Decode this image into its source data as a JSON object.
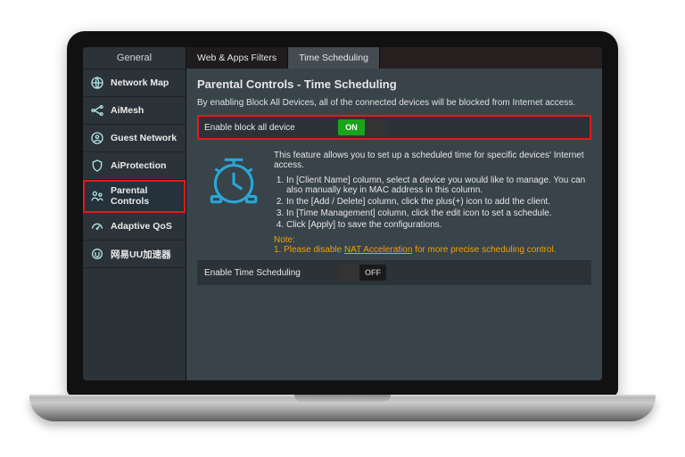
{
  "sidebar": {
    "header": "General",
    "items": [
      {
        "icon": "globe-icon",
        "label": "Network Map"
      },
      {
        "icon": "mesh-icon",
        "label": "AiMesh"
      },
      {
        "icon": "guest-icon",
        "label": "Guest Network"
      },
      {
        "icon": "shield-icon",
        "label": "AiProtection"
      },
      {
        "icon": "family-icon",
        "label": "Parental Controls"
      },
      {
        "icon": "gauge-icon",
        "label": "Adaptive QoS"
      },
      {
        "icon": "accel-icon",
        "label": "网易UU加速器"
      }
    ],
    "active_index": 4
  },
  "tabs": {
    "items": [
      "Web & Apps Filters",
      "Time Scheduling"
    ],
    "active_index": 1
  },
  "page": {
    "title": "Parental Controls - Time Scheduling",
    "subtitle": "By enabling Block All Devices, all of the connected devices will be blocked from Internet access.",
    "row_block": {
      "label": "Enable block all device",
      "state": "ON"
    },
    "feature_desc": "This feature allows you to set up a scheduled time for specific devices' Internet access.",
    "steps": [
      "In [Client Name] column, select a device you would like to manage. You can also manually key in MAC address in this column.",
      "In the [Add / Delete] column, click the plus(+) icon to add the client.",
      "In [Time Management] column, click the edit icon to set a schedule.",
      "Click [Apply] to save the configurations."
    ],
    "note_label": "Note:",
    "note_prefix": "1. Please disable ",
    "note_link": "NAT Acceleration",
    "note_suffix": " for more precise scheduling control.",
    "row_time": {
      "label": "Enable Time Scheduling",
      "state": "OFF"
    }
  }
}
